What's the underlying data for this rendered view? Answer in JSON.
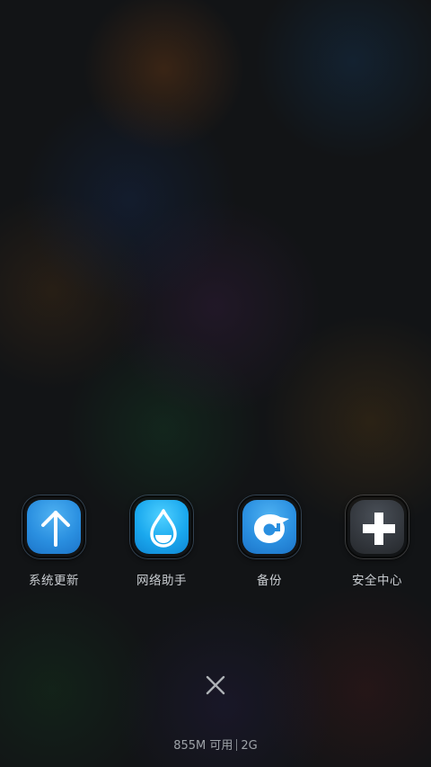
{
  "shortcuts": [
    {
      "label": "系统更新",
      "icon": "arrow-up-icon",
      "color": "#2a8fe0"
    },
    {
      "label": "网络助手",
      "icon": "water-drop-icon",
      "color": "#1aa8ee"
    },
    {
      "label": "备份",
      "icon": "backup-cloud-icon",
      "color": "#2a8fe0"
    },
    {
      "label": "安全中心",
      "icon": "plus-shield-icon",
      "color": "#33373d"
    }
  ],
  "close": {
    "icon": "close-icon"
  },
  "memory": {
    "available": "855M 可用",
    "total": "2G"
  }
}
